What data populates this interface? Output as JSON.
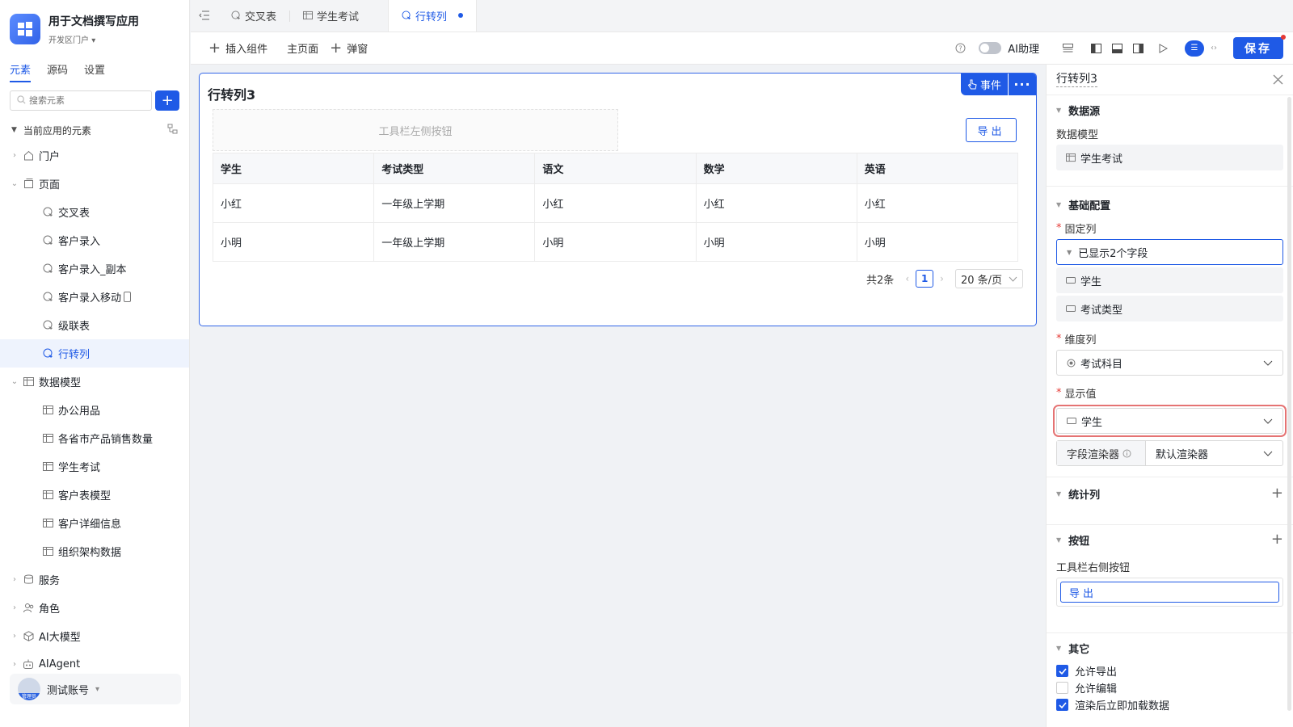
{
  "app": {
    "name": "用于文档撰写应用",
    "env": "开发区门户"
  },
  "sidebar": {
    "tabs": [
      {
        "label": "元素"
      },
      {
        "label": "源码"
      },
      {
        "label": "设置"
      }
    ],
    "search_placeholder": "搜索元素",
    "section_title": "当前应用的元素",
    "items": [
      {
        "label": "门户"
      },
      {
        "label": "页面"
      },
      {
        "label": "交叉表"
      },
      {
        "label": "客户录入"
      },
      {
        "label": "客户录入_副本"
      },
      {
        "label": "客户录入移动"
      },
      {
        "label": "级联表"
      },
      {
        "label": "行转列"
      },
      {
        "label": "数据模型"
      },
      {
        "label": "办公用品"
      },
      {
        "label": "各省市产品销售数量"
      },
      {
        "label": "学生考试"
      },
      {
        "label": "客户表模型"
      },
      {
        "label": "客户详细信息"
      },
      {
        "label": "组织架构数据"
      },
      {
        "label": "服务"
      },
      {
        "label": "角色"
      },
      {
        "label": "AI大模型"
      },
      {
        "label": "AIAgent"
      }
    ],
    "user": {
      "name": "测试账号",
      "role": "管理员"
    }
  },
  "tabs": [
    {
      "label": "交叉表"
    },
    {
      "label": "学生考试"
    },
    {
      "label": "行转列"
    }
  ],
  "toolbar": {
    "insert": "插入组件",
    "main_page": "主页面",
    "popup": "弹窗",
    "ai_label": "AI助理",
    "save": "保存"
  },
  "component": {
    "title": "行转列3",
    "event_label": "事件",
    "toolbar_left_placeholder": "工具栏左侧按钮",
    "export_label": "导出",
    "columns": [
      "学生",
      "考试类型",
      "语文",
      "数学",
      "英语"
    ],
    "rows": [
      [
        "小红",
        "一年级上学期",
        "小红",
        "小红",
        "小红"
      ],
      [
        "小明",
        "一年级上学期",
        "小明",
        "小明",
        "小明"
      ]
    ],
    "pager": {
      "total": "共2条",
      "page": "1",
      "size": "20 条/页"
    }
  },
  "panel": {
    "title": "行转列3",
    "datasource": {
      "title": "数据源",
      "model_label": "数据模型",
      "model_value": "学生考试"
    },
    "basic": {
      "title": "基础配置",
      "fixed_label": "固定列",
      "fixed_summary": "已显示2个字段",
      "fixed_fields": [
        "学生",
        "考试类型"
      ],
      "dim_label": "维度列",
      "dim_value": "考试科目",
      "display_label": "显示值",
      "display_value": "学生",
      "renderer_label": "字段渲染器",
      "renderer_value": "默认渲染器"
    },
    "stats": {
      "title": "统计列"
    },
    "buttons": {
      "title": "按钮",
      "right_label": "工具栏右侧按钮",
      "right_button": "导出"
    },
    "other": {
      "title": "其它",
      "options": [
        {
          "label": "允许导出",
          "checked": true
        },
        {
          "label": "允许编辑",
          "checked": false
        },
        {
          "label": "渲染后立即加载数据",
          "checked": true
        }
      ]
    }
  },
  "colors": {
    "accent": "#1f5ae6",
    "highlight": "#e57373"
  }
}
